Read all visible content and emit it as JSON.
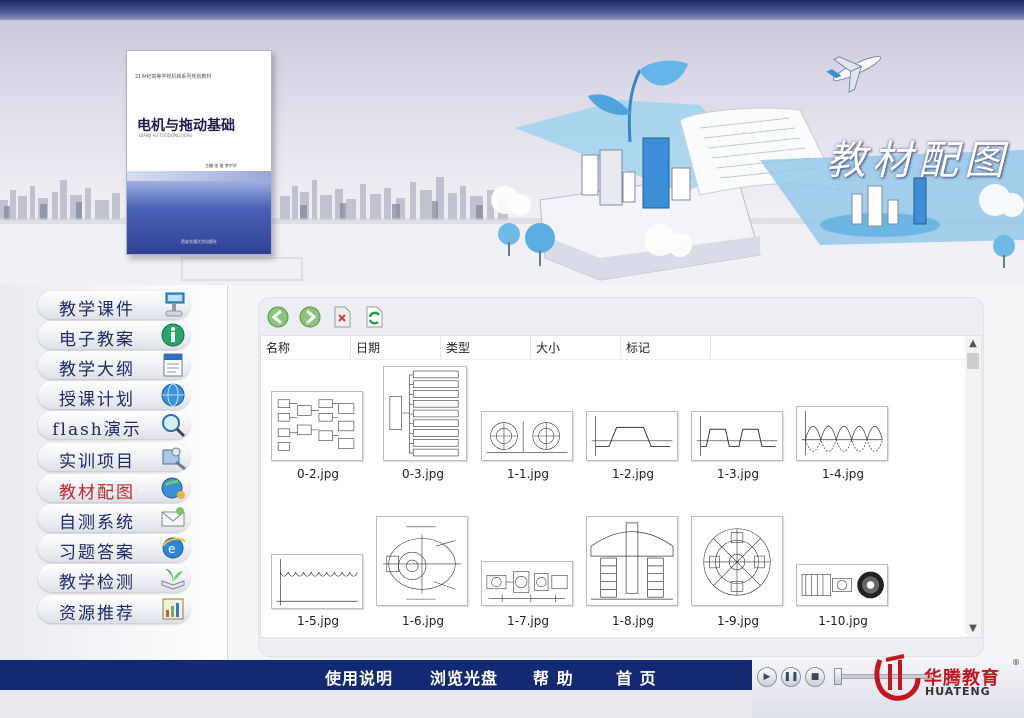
{
  "banner": {
    "book": {
      "series": "21世纪高等学校机械系列规划教材",
      "title": "电机与拖动基础",
      "title_en": "DIANJI YU TUODONG JICHU",
      "authors": "主编  张 琨  李中华",
      "publisher": "西安交通大学出版社"
    },
    "section_title": "教材配图"
  },
  "sidebar": {
    "items": [
      {
        "label": "教学课件",
        "icon": "courseware-icon",
        "active": false
      },
      {
        "label": "电子教案",
        "icon": "info-icon",
        "active": false
      },
      {
        "label": "教学大纲",
        "icon": "news-icon",
        "active": false
      },
      {
        "label": "授课计划",
        "icon": "globe-blue-icon",
        "active": false
      },
      {
        "label": "flash演示",
        "icon": "magnifier-icon",
        "active": false
      },
      {
        "label": "实训项目",
        "icon": "tools-icon",
        "active": false
      },
      {
        "label": "教材配图",
        "icon": "palette-globe-icon",
        "active": true
      },
      {
        "label": "自测系统",
        "icon": "envelope-icon",
        "active": false
      },
      {
        "label": "习题答案",
        "icon": "ie-globe-icon",
        "active": false
      },
      {
        "label": "教学检测",
        "icon": "plant-book-icon",
        "active": false
      },
      {
        "label": "资源推荐",
        "icon": "chart-icon",
        "active": false
      }
    ]
  },
  "toolbar": {
    "back": "back-arrow-icon",
    "forward": "forward-arrow-icon",
    "delete": "delete-icon",
    "refresh": "refresh-icon"
  },
  "file_view": {
    "columns": [
      "名称",
      "日期",
      "类型",
      "大小",
      "标记"
    ],
    "files": [
      {
        "name": "0-2.jpg",
        "kind": "blockdiagram"
      },
      {
        "name": "0-3.jpg",
        "kind": "tree"
      },
      {
        "name": "1-1.jpg",
        "kind": "machine"
      },
      {
        "name": "1-2.jpg",
        "kind": "trapezoid"
      },
      {
        "name": "1-3.jpg",
        "kind": "trapezoid2"
      },
      {
        "name": "1-4.jpg",
        "kind": "waves"
      },
      {
        "name": "1-5.jpg",
        "kind": "ripple"
      },
      {
        "name": "1-6.jpg",
        "kind": "motor"
      },
      {
        "name": "1-7.jpg",
        "kind": "parts"
      },
      {
        "name": "1-8.jpg",
        "kind": "section"
      },
      {
        "name": "1-9.jpg",
        "kind": "assembly"
      },
      {
        "name": "1-10.jpg",
        "kind": "rotor"
      }
    ]
  },
  "footer": {
    "links": [
      "使用说明",
      "浏览光盘",
      "帮  助",
      "首  页"
    ],
    "player": {
      "play": "▶",
      "pause": "❚❚",
      "stop": "■"
    }
  },
  "logo": {
    "cn": "华腾教育",
    "en": "HUATENG",
    "reg": "®",
    "brand_color": "#c4161c"
  },
  "colors": {
    "nav_text": "#1b2a6a",
    "nav_active": "#c2262e",
    "footer_bar": "#132a72"
  }
}
